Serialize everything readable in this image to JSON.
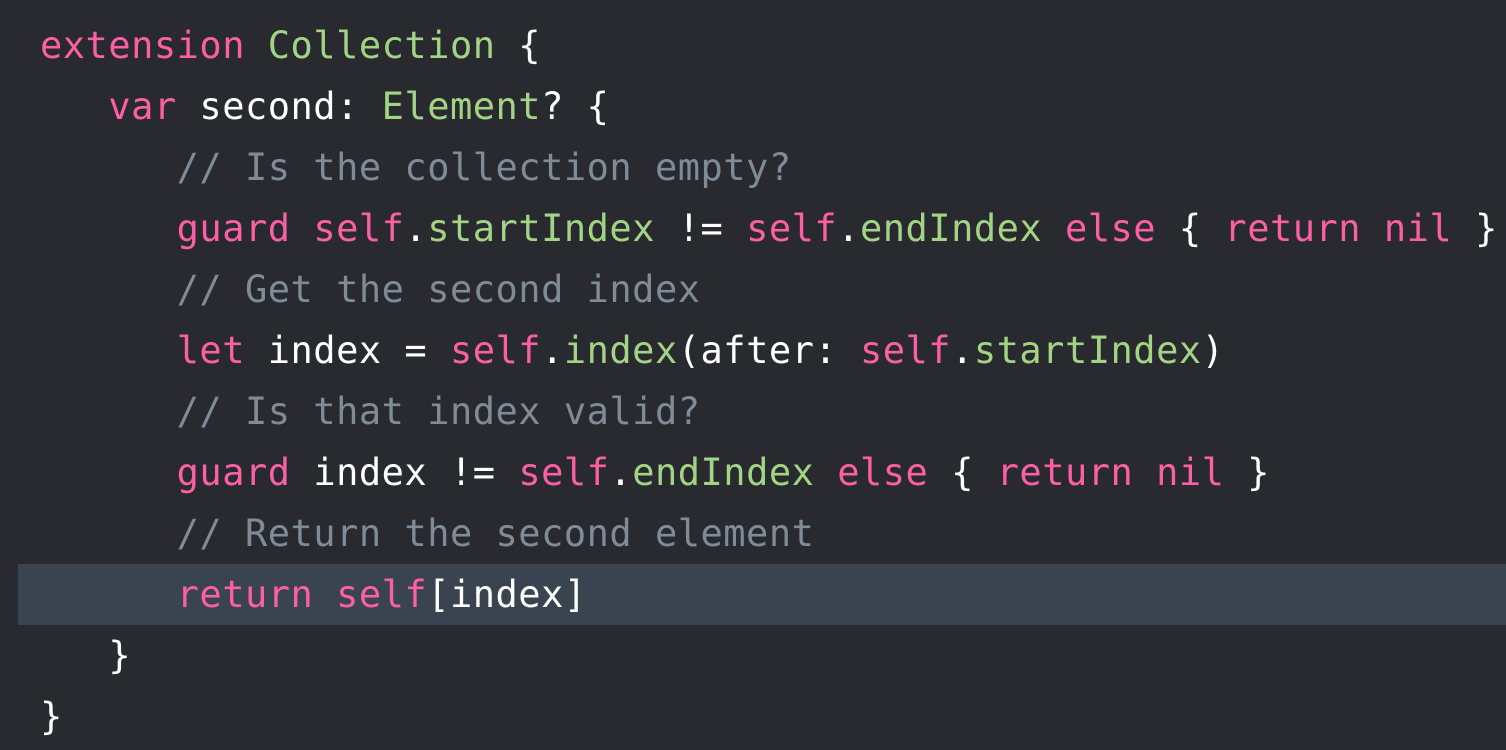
{
  "editor": {
    "highlighted_line": 10,
    "colors": {
      "background": "#292a30",
      "current_line": "#3a4350",
      "keyword": "#fc5fa3",
      "type": "#a3d483",
      "plain": "#ffffff",
      "comment": "#7f8c98"
    },
    "lines": [
      {
        "indent": "",
        "tokens": [
          {
            "t": "extension",
            "k": "keyword"
          },
          {
            "t": " ",
            "k": "plain"
          },
          {
            "t": "Collection",
            "k": "green"
          },
          {
            "t": " {",
            "k": "plain"
          }
        ]
      },
      {
        "indent": "   ",
        "tokens": [
          {
            "t": "var",
            "k": "keyword"
          },
          {
            "t": " second: ",
            "k": "plain"
          },
          {
            "t": "Element",
            "k": "green"
          },
          {
            "t": "? {",
            "k": "plain"
          }
        ]
      },
      {
        "indent": "      ",
        "tokens": [
          {
            "t": "// Is the collection empty?",
            "k": "comment"
          }
        ]
      },
      {
        "indent": "      ",
        "tokens": [
          {
            "t": "guard",
            "k": "keyword"
          },
          {
            "t": " ",
            "k": "plain"
          },
          {
            "t": "self",
            "k": "keyword"
          },
          {
            "t": ".",
            "k": "plain"
          },
          {
            "t": "startIndex",
            "k": "green"
          },
          {
            "t": " != ",
            "k": "plain"
          },
          {
            "t": "self",
            "k": "keyword"
          },
          {
            "t": ".",
            "k": "plain"
          },
          {
            "t": "endIndex",
            "k": "green"
          },
          {
            "t": " ",
            "k": "plain"
          },
          {
            "t": "else",
            "k": "keyword"
          },
          {
            "t": " { ",
            "k": "plain"
          },
          {
            "t": "return",
            "k": "keyword"
          },
          {
            "t": " ",
            "k": "plain"
          },
          {
            "t": "nil",
            "k": "keyword"
          },
          {
            "t": " }",
            "k": "plain"
          }
        ]
      },
      {
        "indent": "      ",
        "tokens": [
          {
            "t": "// Get the second index",
            "k": "comment"
          }
        ]
      },
      {
        "indent": "      ",
        "tokens": [
          {
            "t": "let",
            "k": "keyword"
          },
          {
            "t": " index = ",
            "k": "plain"
          },
          {
            "t": "self",
            "k": "keyword"
          },
          {
            "t": ".",
            "k": "plain"
          },
          {
            "t": "index",
            "k": "green"
          },
          {
            "t": "(after: ",
            "k": "plain"
          },
          {
            "t": "self",
            "k": "keyword"
          },
          {
            "t": ".",
            "k": "plain"
          },
          {
            "t": "startIndex",
            "k": "green"
          },
          {
            "t": ")",
            "k": "plain"
          }
        ]
      },
      {
        "indent": "      ",
        "tokens": [
          {
            "t": "// Is that index valid?",
            "k": "comment"
          }
        ]
      },
      {
        "indent": "      ",
        "tokens": [
          {
            "t": "guard",
            "k": "keyword"
          },
          {
            "t": " index != ",
            "k": "plain"
          },
          {
            "t": "self",
            "k": "keyword"
          },
          {
            "t": ".",
            "k": "plain"
          },
          {
            "t": "endIndex",
            "k": "green"
          },
          {
            "t": " ",
            "k": "plain"
          },
          {
            "t": "else",
            "k": "keyword"
          },
          {
            "t": " { ",
            "k": "plain"
          },
          {
            "t": "return",
            "k": "keyword"
          },
          {
            "t": " ",
            "k": "plain"
          },
          {
            "t": "nil",
            "k": "keyword"
          },
          {
            "t": " }",
            "k": "plain"
          }
        ]
      },
      {
        "indent": "      ",
        "tokens": [
          {
            "t": "// Return the second element",
            "k": "comment"
          }
        ]
      },
      {
        "indent": "      ",
        "tokens": [
          {
            "t": "return",
            "k": "keyword"
          },
          {
            "t": " ",
            "k": "plain"
          },
          {
            "t": "self",
            "k": "keyword"
          },
          {
            "t": "[index]",
            "k": "plain"
          }
        ]
      },
      {
        "indent": "   ",
        "tokens": [
          {
            "t": "}",
            "k": "plain"
          }
        ]
      },
      {
        "indent": "",
        "tokens": [
          {
            "t": "}",
            "k": "plain"
          }
        ]
      }
    ]
  }
}
